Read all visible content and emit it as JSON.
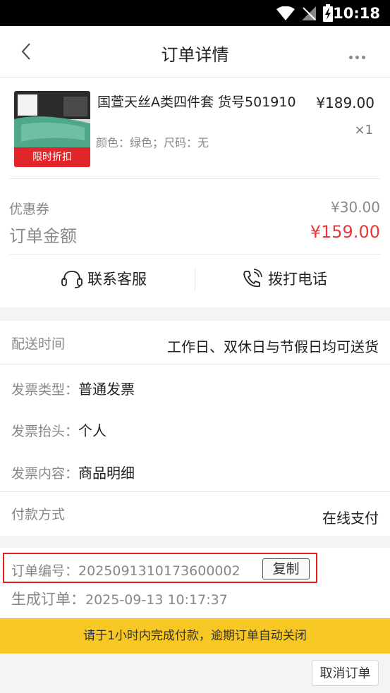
{
  "status_bar": {
    "time": "10:18"
  },
  "header": {
    "title": "订单详情"
  },
  "product": {
    "name": "国萱天丝A类四件套 货号501910",
    "attributes": "颜色：绿色；尺码：无",
    "price": "¥189.00",
    "quantity": "×1",
    "badge": "限时折扣"
  },
  "summary": {
    "coupon_label": "优惠券",
    "coupon_value": "¥30.00",
    "total_label": "订单金额",
    "total_value": "¥159.00"
  },
  "actions": {
    "contact_service": "联系客服",
    "call_phone": "拨打电话"
  },
  "delivery": {
    "label": "配送时间",
    "value": "工作日、双休日与节假日均可送货"
  },
  "invoice": {
    "type_label": "发票类型：",
    "type_value": "普通发票",
    "title_label": "发票抬头：",
    "title_value": "个人",
    "content_label": "发票内容：",
    "content_value": "商品明细"
  },
  "payment": {
    "label": "付款方式",
    "value": "在线支付"
  },
  "order": {
    "number_label": "订单编号：",
    "number_value": "2025091310173600002",
    "copy_label": "复制",
    "created_label": "生成订单：",
    "created_value": "2025-09-13 10:17:37"
  },
  "notice": "请于1小时内完成付款，逾期订单自动关闭",
  "footer": {
    "cancel_label": "取消订单"
  },
  "colors": {
    "accent_red": "#e4393c",
    "notice_yellow": "#f7c824"
  }
}
